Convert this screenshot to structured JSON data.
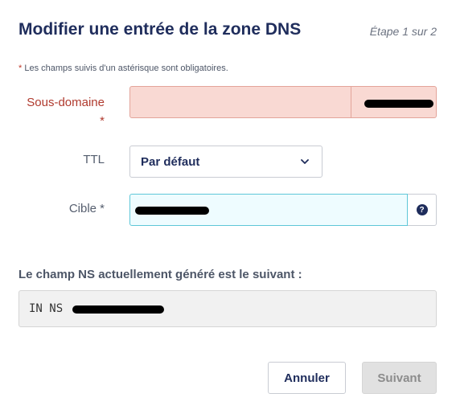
{
  "dialog": {
    "title": "Modifier une entrée de la zone DNS",
    "step": "Étape 1 sur 2",
    "required_note_star": "*",
    "required_note": "Les champs suivis d'un astérisque sont obligatoires."
  },
  "form": {
    "subdomain": {
      "label": "Sous-domaine *",
      "value": "",
      "suffix": ""
    },
    "ttl": {
      "label": "TTL",
      "selected": "Par défaut"
    },
    "target": {
      "label": "Cible *",
      "value": "",
      "help_icon": "question-icon"
    }
  },
  "ns": {
    "label": "Le champ NS actuellement généré est le suivant :",
    "value": "IN NS"
  },
  "buttons": {
    "cancel": "Annuler",
    "next": "Suivant"
  },
  "colors": {
    "error_bg": "#f9d9d3",
    "focus_border": "#5ec7d8",
    "title": "#1f2d5c"
  }
}
